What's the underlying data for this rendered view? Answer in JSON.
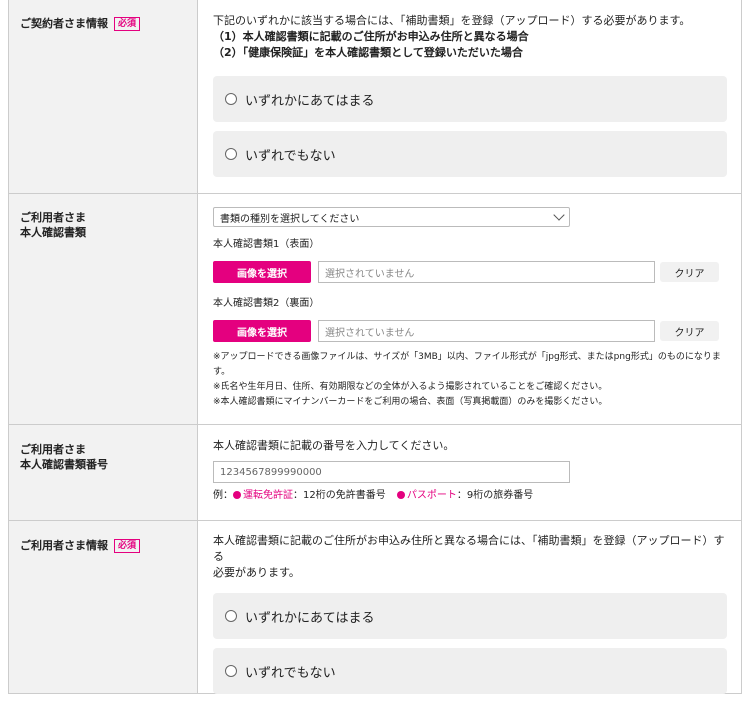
{
  "sections": {
    "contractor": {
      "label": "ご契約者さま情報",
      "required": "必須",
      "description": "下記のいずれかに該当する場合には、「補助書類」を登録（アップロード）する必要があります。",
      "condition1": "（1）本人確認書類に記載のご住所がお申込み住所と異なる場合",
      "condition2": "（2）「健康保険証」を本人確認書類として登録いただいた場合",
      "option_yes": "いずれかにあてはまる",
      "option_no": "いずれでもない"
    },
    "id_docs": {
      "label_line1": "ご利用者さま",
      "label_line2": "本人確認書類",
      "select_value": "書類の種別を選択してください",
      "doc1_label": "本人確認書類1（表面）",
      "doc2_label": "本人確認書類2（裏面）",
      "choose_button": "画像を選択",
      "file_placeholder": "選択されていません",
      "clear_button": "クリア",
      "note1": "※アップロードできる画像ファイルは、サイズが「3MB」以内、ファイル形式が「jpg形式、またはpng形式」のものになります。",
      "note2": "※氏名や生年月日、住所、有効期限などの全体が入るよう撮影されていることをご確認ください。",
      "note3": "※本人確認書類にマイナンバーカードをご利用の場合、表面（写真掲載面）のみを撮影ください。"
    },
    "id_number": {
      "label_line1": "ご利用者さま",
      "label_line2": "本人確認書類番号",
      "instruction": "本人確認書類に記載の番号を入力してください。",
      "input_value": "1234567899990000",
      "example_prefix": "例：",
      "license_link": "運転免許証",
      "license_desc": "：12桁の免許書番号",
      "passport_link": "パスポート",
      "passport_desc": "：9桁の旅券番号"
    },
    "user": {
      "label": "ご利用者さま情報",
      "required": "必須",
      "description_line1": "本人確認書類に記載のご住所がお申込み住所と異なる場合には、「補助書類」を登録（アップロード）する",
      "description_line2": "必要があります。",
      "option_yes": "いずれかにあてはまる",
      "option_no": "いずれでもない"
    }
  }
}
